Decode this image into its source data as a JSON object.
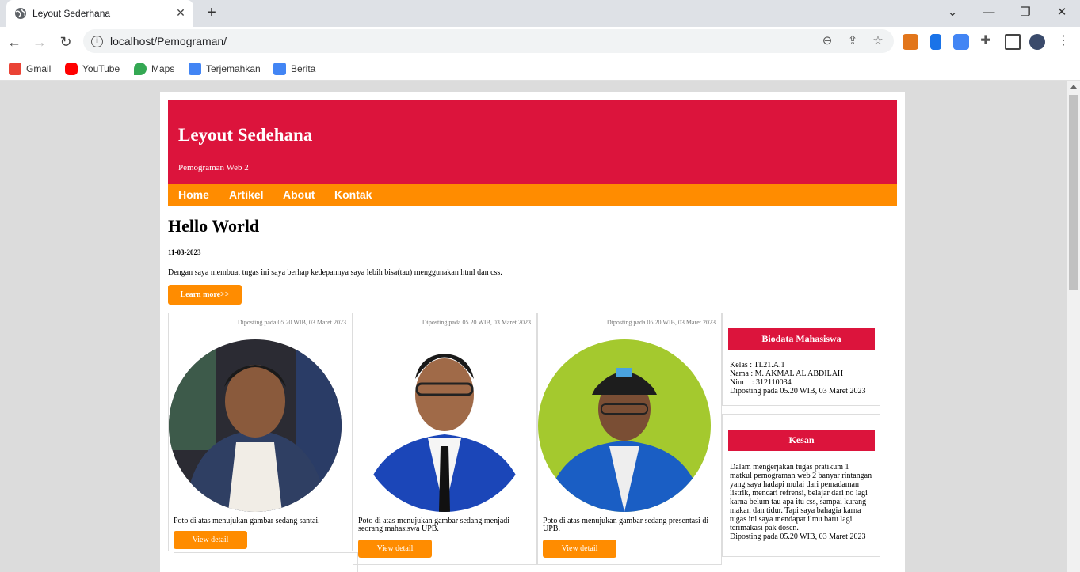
{
  "browser": {
    "tab_title": "Leyout Sederhana",
    "url": "localhost/Pemograman/",
    "bookmarks": [
      {
        "label": "Gmail",
        "icon": "gmail-icon",
        "color": "#ea4335"
      },
      {
        "label": "YouTube",
        "icon": "youtube-icon",
        "color": "#ff0000"
      },
      {
        "label": "Maps",
        "icon": "maps-icon",
        "color": "#34a853"
      },
      {
        "label": "Terjemahkan",
        "icon": "translate-icon",
        "color": "#4285f4"
      },
      {
        "label": "Berita",
        "icon": "news-icon",
        "color": "#4285f4"
      }
    ]
  },
  "site": {
    "title": "Leyout Sedehana",
    "subtitle": "Pemograman Web 2",
    "accent_header": "#dc143c",
    "accent_nav": "#ff8c00",
    "nav": [
      "Home",
      "Artikel",
      "About",
      "Kontak"
    ]
  },
  "content": {
    "title": "Hello World",
    "date": "11-03-2023",
    "text": "Dengan saya membuat tugas ini saya berhap kedepannya saya lebih bisa(tau) menggunakan html dan css.",
    "button": "Learn more>>"
  },
  "cards": [
    {
      "meta": "Diposting pada 05.20 WIB, 03 Maret 2023",
      "caption": "Poto di atas menujukan gambar sedang santai.",
      "button": "View detail"
    },
    {
      "meta": "Diposting pada 05.20 WIB, 03 Maret 2023",
      "caption": "Poto di atas menujukan gambar sedang menjadi seorang mahasiswa UPB.",
      "button": "View detail"
    },
    {
      "meta": "Diposting pada 05.20 WIB, 03 Maret 2023",
      "caption": "Poto di atas menujukan gambar sedang presentasi di UPB.",
      "button": "View detail"
    }
  ],
  "sidebar": {
    "biodata": {
      "title": "Biodata Mahasiswa",
      "kelas": "Kelas : TI.21.A.1",
      "nama": "Nama : M. AKMAL AL ABDILAH",
      "nim": "Nim    : 312110034",
      "posted": "Diposting pada 05.20 WIB, 03 Maret 2023"
    },
    "kesan": {
      "title": "Kesan",
      "text": "Dalam mengerjakan tugas pratikum 1 matkul pemograman web 2 banyar rintangan yang saya hadapi mulai dari pemadaman listrik, mencari refrensi, belajar dari no lagi karna belum tau apa itu css, sampai kurang makan dan tidur. Tapi saya bahagia karna tugas ini saya mendapat ilmu baru lagi terimakasi pak dosen.",
      "posted": "Diposting pada 05.20 WIB, 03 Maret 2023"
    }
  }
}
